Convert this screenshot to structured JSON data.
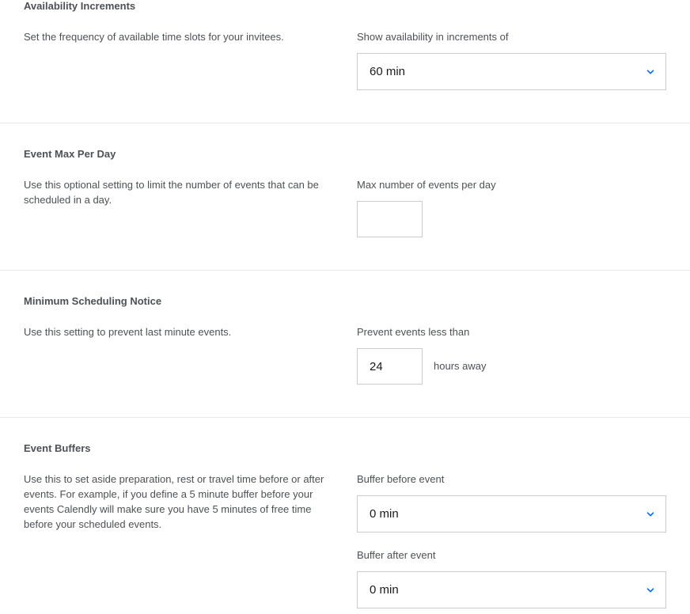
{
  "availability_increments": {
    "heading": "Availability Increments",
    "description": "Set the frequency of available time slots for your invitees.",
    "field_label": "Show availability in increments of",
    "selected": "60 min"
  },
  "event_max_per_day": {
    "heading": "Event Max Per Day",
    "description": "Use this optional setting to limit the number of events that can be scheduled in a day.",
    "field_label": "Max number of events per day",
    "value": ""
  },
  "minimum_scheduling_notice": {
    "heading": "Minimum Scheduling Notice",
    "description": "Use this setting to prevent last minute events.",
    "field_label": "Prevent events less than",
    "value": "24",
    "suffix": "hours away"
  },
  "event_buffers": {
    "heading": "Event Buffers",
    "description": "Use this to set aside preparation, rest or travel time before or after events. For example, if you define a 5 minute buffer before your events Calendly will make sure you have 5 minutes of free time before your scheduled events.",
    "before_label": "Buffer before event",
    "before_selected": "0 min",
    "after_label": "Buffer after event",
    "after_selected": "0 min"
  },
  "colors": {
    "accent": "#006bff",
    "text": "#4d5055",
    "border": "#c9cbd0",
    "divider": "#e8e8e8"
  },
  "icons": {
    "dropdown": "chevron-down-icon"
  }
}
